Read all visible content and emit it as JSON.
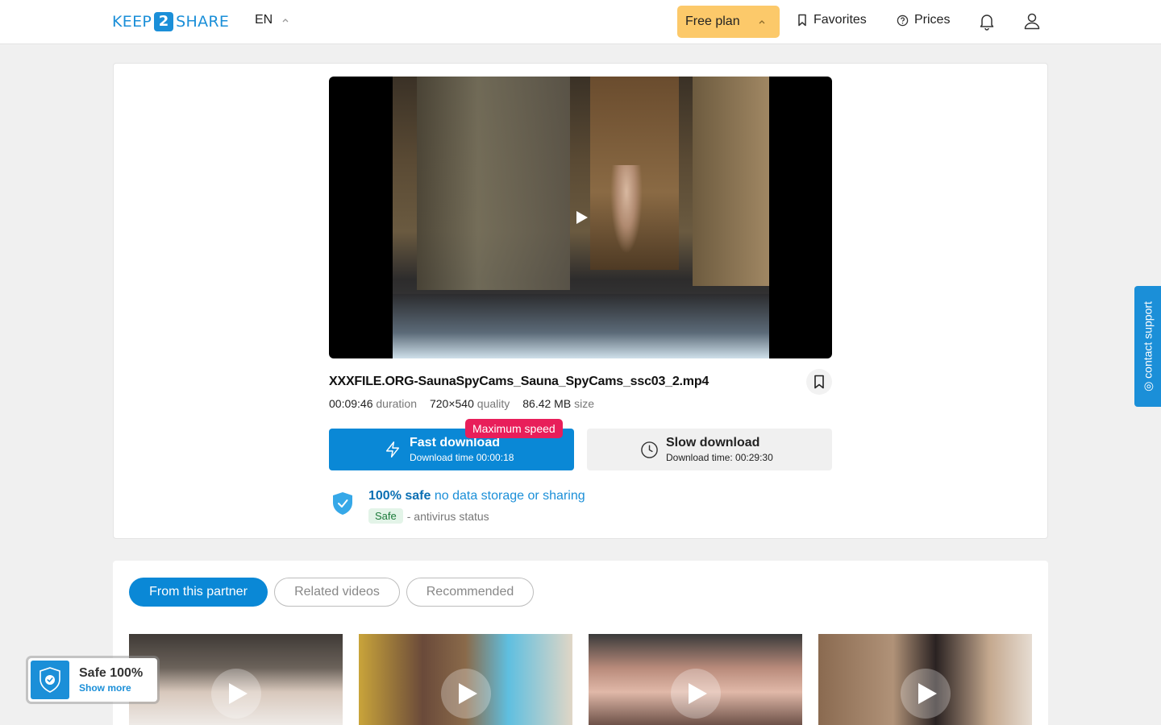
{
  "header": {
    "logo_left": "KEEP",
    "logo_mid": "2",
    "logo_right": "SHARE",
    "language": "EN",
    "plan_label": "Free plan",
    "favorites_label": "Favorites",
    "prices_label": "Prices"
  },
  "file": {
    "name": "XXXFILE.ORG-SaunaSpyCams_Sauna_SpyCams_ssc03_2.mp4",
    "duration_value": "00:09:46",
    "duration_label": "duration",
    "quality_value": "720×540",
    "quality_label": "quality",
    "size_value": "86.42 MB",
    "size_label": "size"
  },
  "download": {
    "badge": "Maximum speed",
    "fast_title": "Fast download",
    "fast_sub": "Download time 00:00:18",
    "slow_title": "Slow download",
    "slow_sub": "Download time: 00:29:30"
  },
  "safety": {
    "bold": "100% safe",
    "rest": "no data storage or sharing",
    "pill": "Safe",
    "status": "- antivirus status"
  },
  "tabs": [
    {
      "label": "From this partner",
      "active": true
    },
    {
      "label": "Related videos",
      "active": false
    },
    {
      "label": "Recommended",
      "active": false
    }
  ],
  "support": {
    "label": "◎ contact support"
  },
  "safe_widget": {
    "title": "Safe 100%",
    "link": "Show more"
  },
  "colors": {
    "brand": "#1b8fd8",
    "fast_button": "#0a88d6",
    "badge": "#e81e5a",
    "plan_button": "#fcc96a"
  }
}
